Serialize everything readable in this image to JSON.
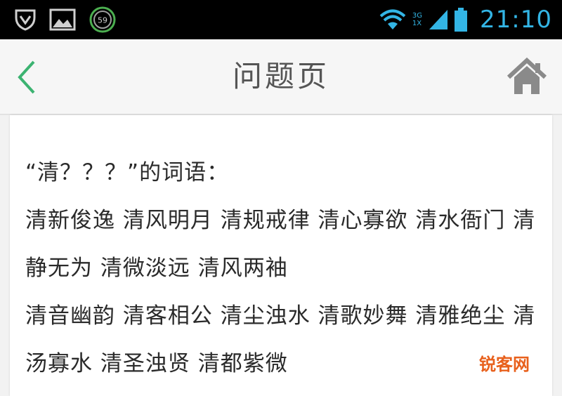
{
  "status_bar": {
    "icons": [
      "shield-icon",
      "image-icon",
      "badge-icon"
    ],
    "badge_count": "59",
    "network_top": "3G",
    "network_bottom": "1X",
    "time": "21:10",
    "accent_color": "#33b5e5"
  },
  "header": {
    "title": "问题页",
    "back_icon": "chevron-left-icon",
    "home_icon": "home-icon",
    "back_color": "#3cb371"
  },
  "content": {
    "question": "“清？？？”的词语：\n清新俊逸 清风明月 清规戒律 清心寡欲 清水衙门 清静无为 清微淡远 清风两袖\n清音幽韵 清客相公 清尘浊水 清歌妙舞 清雅绝尘 清汤寡水 清圣浊贤 清都紫微"
  },
  "watermark": {
    "text": "锐客网"
  }
}
